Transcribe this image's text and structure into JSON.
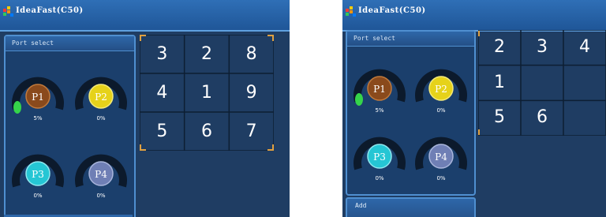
{
  "app": {
    "title": "IdeaFast(C50)",
    "accent": "#2f6fb6",
    "background": "#1f3d63"
  },
  "left_screenshot": {
    "title": "IdeaFast(C50)",
    "panel_title": "Port select",
    "ports": [
      {
        "label": "P1",
        "percent": "5%",
        "level": 0.05,
        "color": "#8a4a1c"
      },
      {
        "label": "P2",
        "percent": "0%",
        "level": 0,
        "color": "#e6d21a"
      },
      {
        "label": "P3",
        "percent": "0%",
        "level": 0,
        "color": "#25c6d4"
      },
      {
        "label": "P4",
        "percent": "0%",
        "level": 0,
        "color": "#6f7fb5"
      }
    ],
    "grid": [
      [
        "3",
        "2",
        "8"
      ],
      [
        "4",
        "1",
        "9"
      ],
      [
        "5",
        "6",
        "7"
      ]
    ]
  },
  "right_screenshot": {
    "title": "IdeaFast(C50)",
    "panel_title": "Port select",
    "add_label": "Add",
    "ports": [
      {
        "label": "P1",
        "percent": "5%",
        "level": 0.05,
        "color": "#8a4a1c"
      },
      {
        "label": "P2",
        "percent": "0%",
        "level": 0,
        "color": "#e6d21a"
      },
      {
        "label": "P3",
        "percent": "0%",
        "level": 0,
        "color": "#25c6d4"
      },
      {
        "label": "P4",
        "percent": "0%",
        "level": 0,
        "color": "#6f7fb5"
      }
    ],
    "grid": [
      [
        "2",
        "3",
        "4"
      ],
      [
        "1",
        "",
        ""
      ],
      [
        "5",
        "6",
        ""
      ]
    ]
  }
}
